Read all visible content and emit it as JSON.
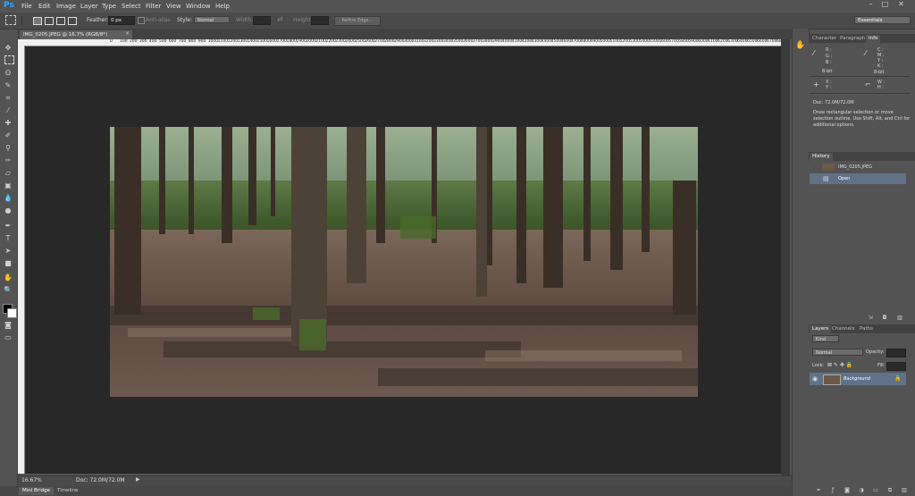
{
  "app": {
    "logo": "Ps"
  },
  "menu": [
    "File",
    "Edit",
    "Image",
    "Layer",
    "Type",
    "Select",
    "Filter",
    "View",
    "Window",
    "Help"
  ],
  "window_controls": [
    "–",
    "□",
    "✕"
  ],
  "options_bar": {
    "feather_label": "Feather:",
    "feather_value": "0 px",
    "anti_alias_label": "Anti-alias",
    "style_label": "Style:",
    "style_value": "Normal",
    "width_label": "Width:",
    "height_label": "Height:",
    "refine_edge_label": "Refine Edge...",
    "workspace": "Essentials"
  },
  "document": {
    "tab_title": "IMG_0205.JPEG @ 16.7% (RGB/8*)",
    "ruler_ticks": [
      "0",
      "100",
      "200",
      "300",
      "400",
      "500",
      "600",
      "700",
      "800",
      "900",
      "1000",
      "1100",
      "1200",
      "1300",
      "1400",
      "1500",
      "1600",
      "1700",
      "1800",
      "1900",
      "2000",
      "2100",
      "2200",
      "2300",
      "2400",
      "2500",
      "2600",
      "2700",
      "2800",
      "2900",
      "3000",
      "3100",
      "3200",
      "3300",
      "3400",
      "3500",
      "3600",
      "3700",
      "3800",
      "3900",
      "4000",
      "4100",
      "4200",
      "4300",
      "4400",
      "4500",
      "4600",
      "4700",
      "4800",
      "4900",
      "5000",
      "5100",
      "5200",
      "5300",
      "5400",
      "5500",
      "5600",
      "5700",
      "5800",
      "5900",
      "6000",
      "6100",
      "6200",
      "6300",
      "6400",
      "6500",
      "6600",
      "6700",
      "6800",
      "6900",
      "7000",
      "7100",
      "7200",
      "7300",
      "7400",
      "7500",
      "7600",
      "7700",
      "7800",
      "7900",
      "8000",
      "8100",
      "8200"
    ]
  },
  "status": {
    "zoom": "16.67%",
    "doc_info": "Doc: 72.0M/72.0M"
  },
  "bottom_tabs": [
    "Mini Bridge",
    "Timeline"
  ],
  "panels": {
    "top_tabs": [
      "Character",
      "Paragraph",
      "Info"
    ],
    "info": {
      "r": "R :",
      "g": "G :",
      "b": "B :",
      "bit_left": "8-bit",
      "c": "C :",
      "m": "M :",
      "y": "Y :",
      "k": "K :",
      "bit_right": "8-bit",
      "x": "X :",
      "y_coord": "Y :",
      "w": "W :",
      "h": "H :",
      "doc": "Doc: 72.0M/72.0M",
      "description": "Draw rectangular selection or move selection outline. Use Shift, Alt, and Ctrl for additional options."
    },
    "history": {
      "title": "History",
      "snapshot": "IMG_0205.JPEG",
      "items": [
        "Open"
      ]
    },
    "layers": {
      "tabs": [
        "Layers",
        "Channels",
        "Paths"
      ],
      "kind_label": "Kind",
      "blend_mode": "Normal",
      "opacity_label": "Opacity:",
      "lock_label": "Lock:",
      "fill_label": "Fill:",
      "layer_name": "Background"
    }
  },
  "colors": {
    "accent_blue": "#31a8ff",
    "selected_row": "#5f7287",
    "canvas_bg": "#282828"
  },
  "icons": [
    "marquee-icon",
    "lasso-icon",
    "crop-icon",
    "brush-icon",
    "type-icon",
    "hand-icon",
    "zoom-icon"
  ]
}
